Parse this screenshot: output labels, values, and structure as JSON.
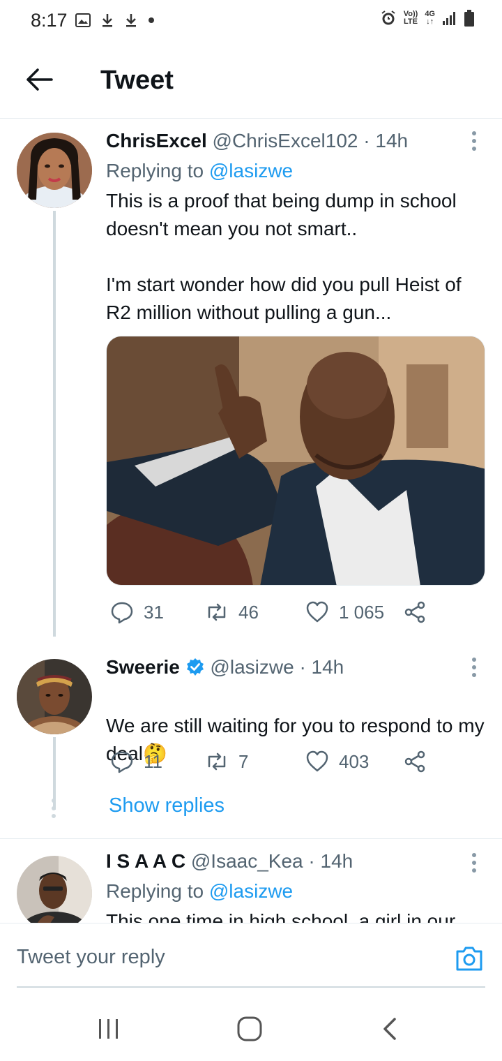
{
  "status_bar": {
    "time": "8:17",
    "volte_line1": "Vo))",
    "volte_line2": "LTE",
    "network_type": "4G"
  },
  "header": {
    "title": "Tweet"
  },
  "tweets": [
    {
      "name": "ChrisExcel",
      "handle": "@ChrisExcel102",
      "time": "· 14h",
      "replying_prefix": "Replying to",
      "replying_handle": "@lasizwe",
      "text": "This is a proof that being dump in school doesn't mean you not smart..\n\nI'm start wonder how did you pull Heist of R2 million without pulling a gun...",
      "replies": "31",
      "retweets": "46",
      "likes": "1 065"
    },
    {
      "name": "Sweerie",
      "verified": true,
      "handle": "@lasizwe",
      "time": "· 14h",
      "text": "We are still waiting for you to respond to my deal",
      "emoji": "🤔",
      "replies": "11",
      "retweets": "7",
      "likes": "403",
      "show_replies": "Show replies"
    },
    {
      "name": "I S A A C",
      "handle": "@Isaac_Kea",
      "time": "· 14h",
      "replying_prefix": "Replying to",
      "replying_handle": "@lasizwe",
      "text": "This one time in high school, a girl in our"
    }
  ],
  "reply_bar": {
    "placeholder": "Tweet your reply"
  },
  "colors": {
    "link": "#1d9bf0",
    "secondary_text": "#536471",
    "thread_line": "#cfd9de"
  }
}
